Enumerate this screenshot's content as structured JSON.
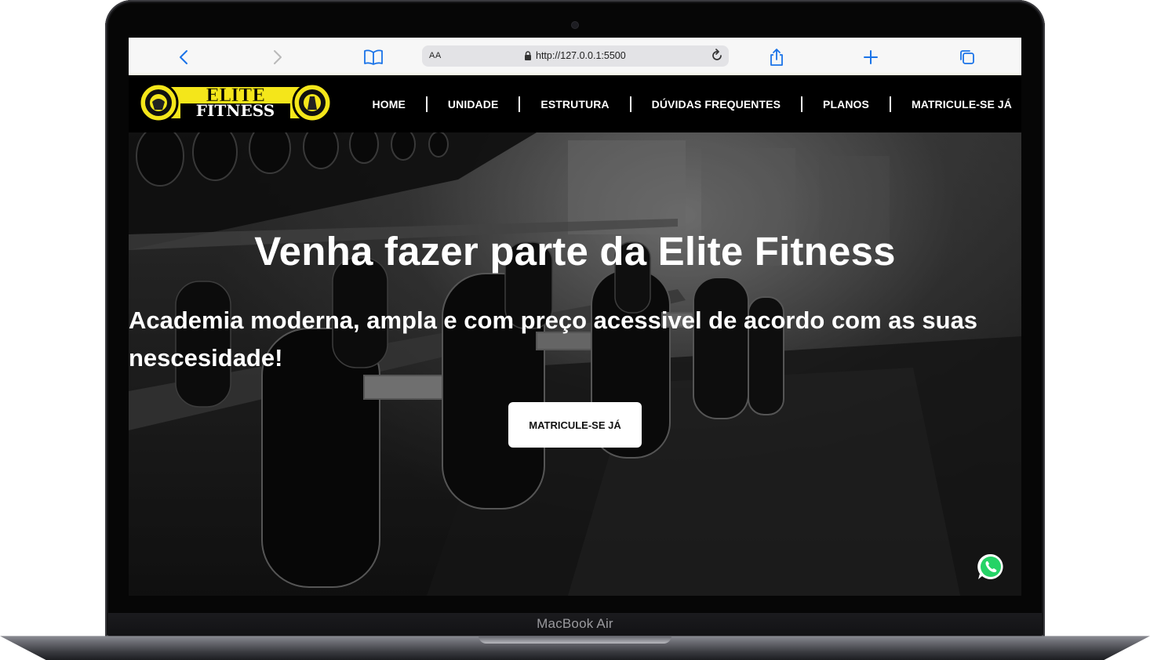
{
  "browser": {
    "aa_label": "AA",
    "url": "http://127.0.0.1:5500"
  },
  "site": {
    "logo_text": [
      "ELITE",
      "FITNESS"
    ],
    "nav": [
      {
        "label": "HOME"
      },
      {
        "label": "UNIDADE"
      },
      {
        "label": "ESTRUTURA"
      },
      {
        "label": "DÚVIDAS FREQUENTES"
      },
      {
        "label": "PLANOS"
      },
      {
        "label": "MATRICULE-SE JÁ"
      }
    ]
  },
  "hero": {
    "title": "Venha fazer parte da Elite Fitness",
    "subtitle": "Academia moderna, ampla e com preço acessivel de acordo com as suas nescesidade!",
    "cta_label": "MATRICULE-SE JÁ"
  },
  "device": {
    "label": "MacBook Air"
  },
  "colors": {
    "brand_yellow": "#f4e61a",
    "nav_background": "#000000",
    "nav_border": "#c8c81a",
    "whatsapp_green": "#25d366",
    "browser_accent": "#1a73e8"
  },
  "icons": [
    "back-arrow-icon",
    "forward-arrow-icon",
    "bookmarks-icon",
    "lock-icon",
    "reload-icon",
    "share-icon",
    "new-tab-icon",
    "tabs-icon",
    "whatsapp-icon"
  ]
}
